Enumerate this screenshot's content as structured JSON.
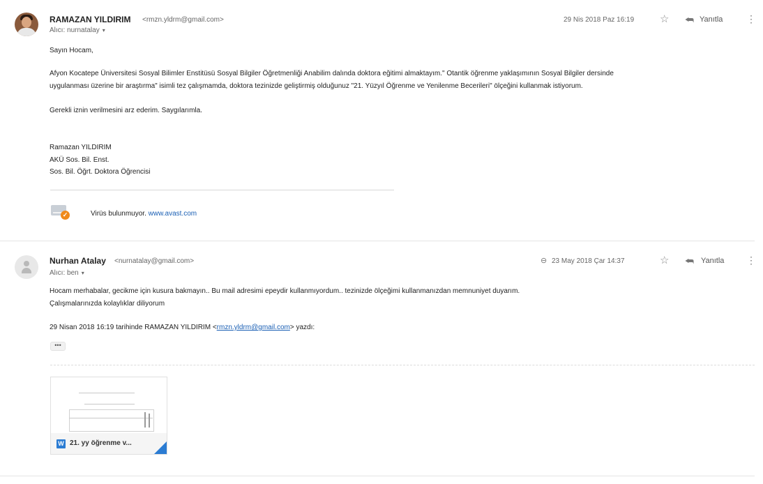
{
  "message1": {
    "sender_name": "RAMAZAN YILDIRIM",
    "sender_email": "<rmzn.yldrm@gmail.com>",
    "to_label": "Alıcı: nurnatalay",
    "date": "29 Nis 2018 Paz 16:19",
    "reply_label": "Yanıtla",
    "body": {
      "greeting": "Sayın Hocam,",
      "para1_line1": "Afyon Kocatepe Üniversitesi Sosyal Bilimler Enstitüsü Sosyal Bilgiler Öğretmenliği Anabilim dalında doktora eğitimi almaktayım.\" Otantik öğrenme yaklaşımının Sosyal Bilgiler dersinde",
      "para1_line2": "uygulanması üzerine bir araştırma\" isimli tez çalışmamda, doktora tezinizde geliştirmiş olduğunuz \"21. Yüzyıl Öğrenme ve Yenilenme Becerileri\" ölçeğini kullanmak istiyorum.",
      "request": "Gerekli iznin verilmesini arz ederim. Saygılarımla.",
      "signature_name": "Ramazan YILDIRIM",
      "signature_institution": "AKÜ Sos. Bil. Enst.",
      "signature_title": "Sos. Bil. Öğrt. Doktora Öğrencisi"
    },
    "avast": {
      "text": "Virüs bulunmuyor.",
      "link": "www.avast.com"
    }
  },
  "message2": {
    "sender_name": "Nurhan Atalay",
    "sender_email": "<nurnatalay@gmail.com>",
    "to_label": "Alıcı: ben",
    "date": "23 May 2018 Çar 14:37",
    "reply_label": "Yanıtla",
    "body": {
      "line1": "Hocam merhabalar, gecikme için kusura bakmayın.. Bu mail adresimi epeydir kullanmıyordum.. tezinizde ölçeğimi kullanmanızdan memnuniyet duyarım.",
      "line2": "Çalışmalarınızda kolaylıklar diliyorum",
      "quote_prefix": "29 Nisan 2018 16:19 tarihinde RAMAZAN YILDIRIM <",
      "quote_email": "rmzn.yldrm@gmail.com",
      "quote_suffix": "> yazdı:",
      "ellipsis": "•••"
    },
    "attachment": {
      "name": "21. yy öğrenme v...",
      "type_letter": "W"
    }
  },
  "icons": {
    "star": "☆",
    "reply": "⮪",
    "more": "⋮",
    "clip": "⊖",
    "caret": "▾",
    "check": "✓"
  },
  "colors": {
    "link": "#1a5fb4",
    "avast_badge": "#f08a1c",
    "word_blue": "#2b7cd3"
  }
}
